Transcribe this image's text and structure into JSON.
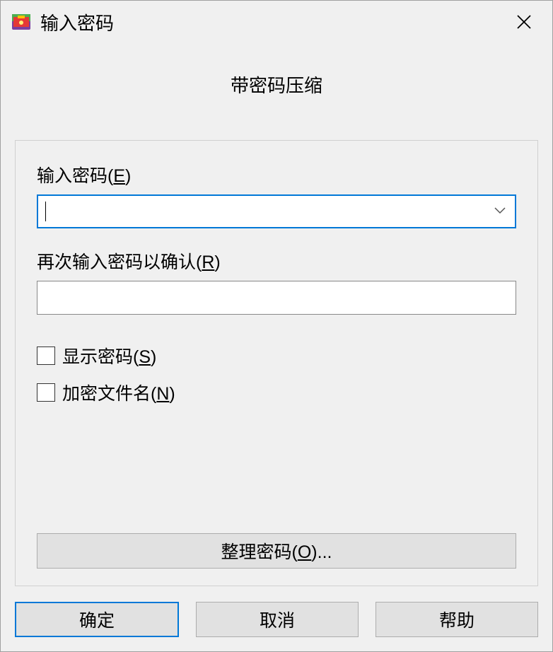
{
  "titlebar": {
    "title": "输入密码"
  },
  "dialog": {
    "subtitle": "带密码压缩",
    "password_label_pre": "输入密码(",
    "password_label_key": "E",
    "password_label_post": ")",
    "password_value": "",
    "confirm_label_pre": "再次输入密码以确认(",
    "confirm_label_key": "R",
    "confirm_label_post": ")",
    "confirm_value": "",
    "show_password_pre": "显示密码(",
    "show_password_key": "S",
    "show_password_post": ")",
    "encrypt_names_pre": "加密文件名(",
    "encrypt_names_key": "N",
    "encrypt_names_post": ")",
    "organize_pre": "整理密码(",
    "organize_key": "O",
    "organize_post": ")..."
  },
  "buttons": {
    "ok": "确定",
    "cancel": "取消",
    "help": "帮助"
  }
}
